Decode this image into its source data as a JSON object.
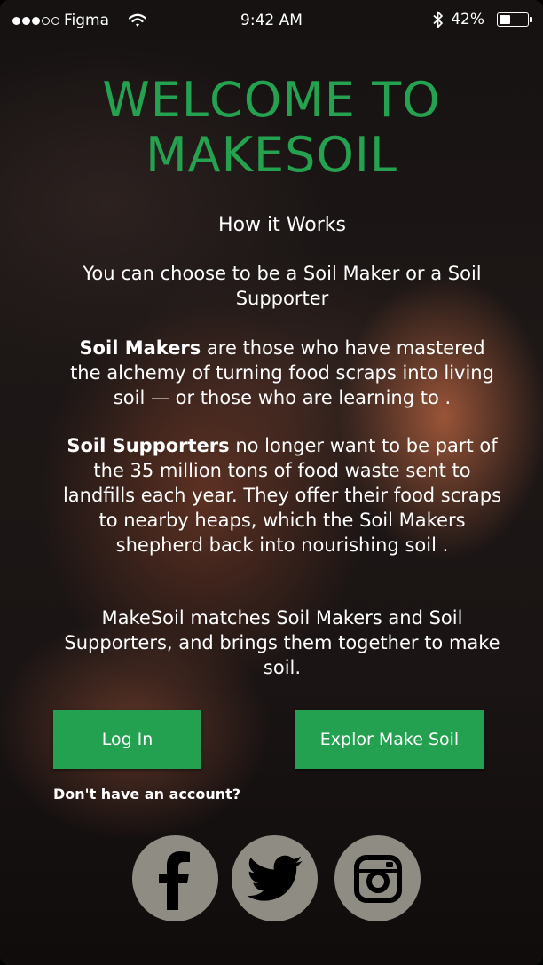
{
  "status_bar": {
    "signal_filled": 3,
    "signal_total": 5,
    "carrier": "Figma",
    "time": "9:42 AM",
    "battery": "42%",
    "battery_level": 0.42
  },
  "title_line1": "WELCOME TO",
  "title_line2": "MAKESOIL",
  "how_it_works": "How it Works",
  "choose_text": "You can choose to be  a Soil Maker or  a Soil Supporter",
  "makers": {
    "bold": "Soil Makers",
    "text": " are those who have mastered the alchemy of turning food scraps into living soil — or those who are learning to ."
  },
  "supporters": {
    "bold": "Soil Supporters",
    "text": " no longer want to be part of the 35 million tons of food waste sent to landfills each year. They offer their food scraps to nearby heaps, which the Soil Makers shepherd back into nourishing soil ."
  },
  "matches_text": "MakeSoil matches Soil Makers and Soil Supporters, and brings them together to make soil.",
  "buttons": {
    "login": "Log In",
    "explore": "Explor Make Soil"
  },
  "signup_link": "Don't have an account?",
  "social": [
    "facebook-icon",
    "twitter-icon",
    "instagram-icon"
  ],
  "colors": {
    "accent_green": "#23a050",
    "title_green": "#25a250",
    "social_gray": "#8f8d83"
  }
}
